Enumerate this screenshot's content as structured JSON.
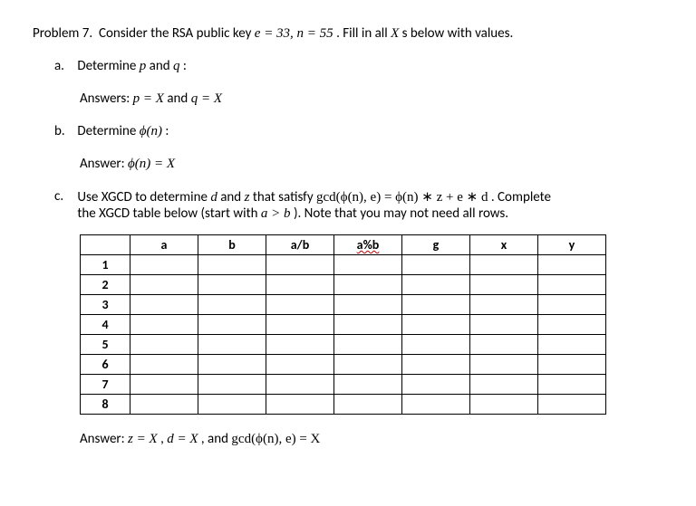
{
  "problem": {
    "title": "Problem 7.",
    "prompt_a": "Consider the RSA public key ",
    "eq1": "e = 33, n = 55",
    "prompt_b": ". Fill in all ",
    "xs": "X",
    "prompt_c": "s below with values."
  },
  "partA": {
    "label": "a.",
    "text_a": "Determine ",
    "p": "p",
    "and1": " and ",
    "q": "q",
    "colon": ":",
    "ans_lead": "Answers: ",
    "ans_p": "p = X",
    "ans_and": " and ",
    "ans_q": "q = X"
  },
  "partB": {
    "label": "b.",
    "text": "Determine ",
    "phi": "ϕ(n)",
    "colon": ":",
    "ans_lead": "Answer: ",
    "ans_eq": "ϕ(n) = X"
  },
  "partC": {
    "label": "c.",
    "line1_a": "Use XGCD to determine ",
    "d": "d",
    "and": " and ",
    "z": "z",
    "line1_b": " that satisfy ",
    "gcd": "gcd(ϕ(n), e) = ϕ(n) ∗ z + e ∗ d",
    "line1_c": ". Complete",
    "line2_a": "the XGCD table below (start with ",
    "agtb": "a > b",
    "line2_b": "). Note that you may not need all rows."
  },
  "table": {
    "headers": [
      "a",
      "b",
      "a/b",
      "a%b",
      "g",
      "x",
      "y"
    ],
    "rows": [
      "1",
      "2",
      "3",
      "4",
      "5",
      "6",
      "7",
      "8"
    ]
  },
  "answerC": {
    "lead": "Answer: ",
    "zeq": "z = X",
    "c1": ", ",
    "deq": "d = X",
    "c2": ", and ",
    "gcd": "gcd(ϕ(n), e) = X"
  }
}
